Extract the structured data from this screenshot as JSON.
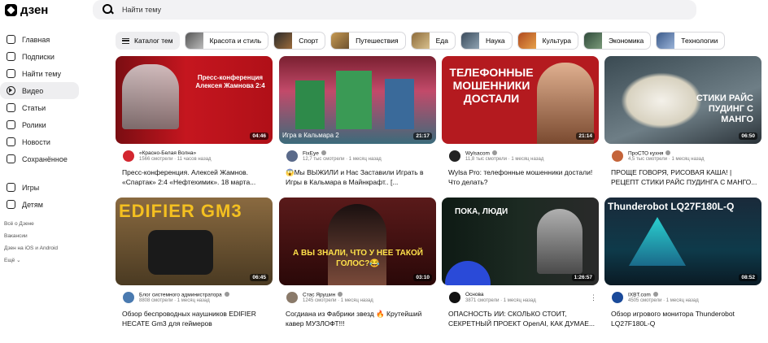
{
  "app": {
    "logo_text": "дзен"
  },
  "search": {
    "placeholder": "Найти тему"
  },
  "sidebar": {
    "items": [
      {
        "label": "Главная"
      },
      {
        "label": "Подписки"
      },
      {
        "label": "Найти тему"
      },
      {
        "label": "Видео"
      },
      {
        "label": "Статьи"
      },
      {
        "label": "Ролики"
      },
      {
        "label": "Новости"
      },
      {
        "label": "Сохранённое"
      },
      {
        "label": "Игры"
      },
      {
        "label": "Детям"
      }
    ],
    "links": [
      "Всё о Дзене",
      "Вакансии",
      "Дзен на iOS и Android",
      "Ещё"
    ]
  },
  "categories": {
    "catalog_label": "Каталог тем",
    "items": [
      "Красота и стиль",
      "Спорт",
      "Путешествия",
      "Еда",
      "Наука",
      "Культура",
      "Экономика",
      "Технологии"
    ]
  },
  "videos": [
    {
      "channel": "«Красно-Белая Волна»",
      "stats": "1566 смотрели · 11 часов назад",
      "title": "Пресс-конференция. Алексей Жамнов. «Спартак» 2:4 «Нефтехимик». 18 марта...",
      "duration": "04:46",
      "overlay": "Пресс-конференция Алексея Жамнова 2:4"
    },
    {
      "channel": "FixEye",
      "stats": "12,7 тыс смотрели · 1 месяц назад",
      "title": "😱Мы ВЫЖИЛИ и Нас Заставили Играть в Игры в Кальмара в Майнкрафт.. [...",
      "duration": "21:17",
      "overlay": "Игра в Кальмара 2"
    },
    {
      "channel": "Wylsacom",
      "stats": "11,8 тыс смотрели · 1 месяц назад",
      "title": "Wylsa Pro: телефонные мошенники достали! Что делать?",
      "duration": "21:14",
      "overlay": "ТЕЛЕФОННЫЕ МОШЕННИКИ ДОСТАЛИ"
    },
    {
      "channel": "ПроСТО кухня",
      "stats": "4,5 тыс смотрели · 1 месяц назад",
      "title": "ПРОЩЕ ГОВОРЯ, РИСОВАЯ КАША! | РЕЦЕПТ СТИКИ РАЙС ПУДИНГА С МАНГО...",
      "duration": "06:50",
      "overlay": "СТИКИ РАЙС ПУДИНГ С МАНГО"
    },
    {
      "channel": "Блог системного администратора",
      "stats": "8808 смотрели · 1 месяц назад",
      "title": "Обзор беспроводных наушников EDIFIER HECATE Gm3 для геймеров",
      "duration": "06:45",
      "overlay": "EDIFIER GM3"
    },
    {
      "channel": "Стас Ярушин",
      "stats": "1245 смотрели · 1 месяц назад",
      "title": "Согдиана из Фабрики звезд 🔥 Крутейший кавер МУЗЛОФТ!!!",
      "duration": "03:10",
      "overlay": "А ВЫ ЗНАЛИ, ЧТО У НЕЕ ТАКОЙ ГОЛОС?😂"
    },
    {
      "channel": "Основа",
      "stats": "3871 смотрели · 1 месяц назад",
      "title": "ОПАСНОСТЬ ИИ: СКОЛЬКО СТОИТ, СЕКРЕТНЫЙ ПРОЕКТ OpenAI, КАК ДУМАЕ...",
      "duration": "1:26:57",
      "overlay": "ПОКА, ЛЮДИ"
    },
    {
      "channel": "IXBT.com",
      "stats": "4505 смотрели · 1 месяц назад",
      "title": "Обзор игрового монитора Thunderobot LQ27F180L-Q",
      "duration": "08:52",
      "overlay": "Thunderobot LQ27F180L-Q"
    }
  ],
  "colors": {
    "accent": "#000000",
    "chip_bg": "#eeeef0"
  }
}
